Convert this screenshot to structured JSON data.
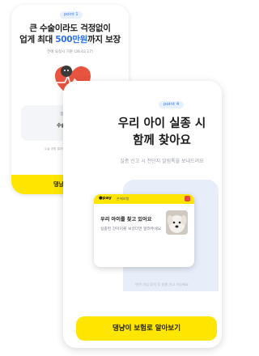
{
  "back_card": {
    "pill": "point 1",
    "title_line1": "큰 수술이라도 걱정없이",
    "title_line2_pre": "업게 최대 ",
    "title_line2_highlight": "500만원",
    "title_line2_post": "까지 보장",
    "subtitle": "전에 요청시 기준 (26.02.17)",
    "box_label": "접목 후 수술",
    "box_value": "수술 담당 보",
    "note": "수술 경험 결과에 따라 보장 금액이 달라요",
    "button": "댕냥이 보험로"
  },
  "front_card": {
    "pill": "point 4",
    "title_line1": "우리 아이 실종 시",
    "title_line2": "함께 찾아요",
    "subtitle": "실종 신고 시 전단지 알림톡을 보내드려요",
    "notification": {
      "brand": "●pay",
      "tag": "손해보험",
      "title": "우리 아이를 찾고 있어요",
      "body": "실종된 강아지를 보셨다면 알려주세요"
    },
    "note": "반려 가입 동의 후 실종 신고 가능해요",
    "button": "댕냥이 보험로 알아보기"
  },
  "colors": {
    "accent_yellow": "#ffe600",
    "accent_blue": "#2f6fe8",
    "pill_bg": "#e6f0ff"
  },
  "icons": [
    "heart-mascot-icon",
    "alarm-icon",
    "dog-photo"
  ]
}
